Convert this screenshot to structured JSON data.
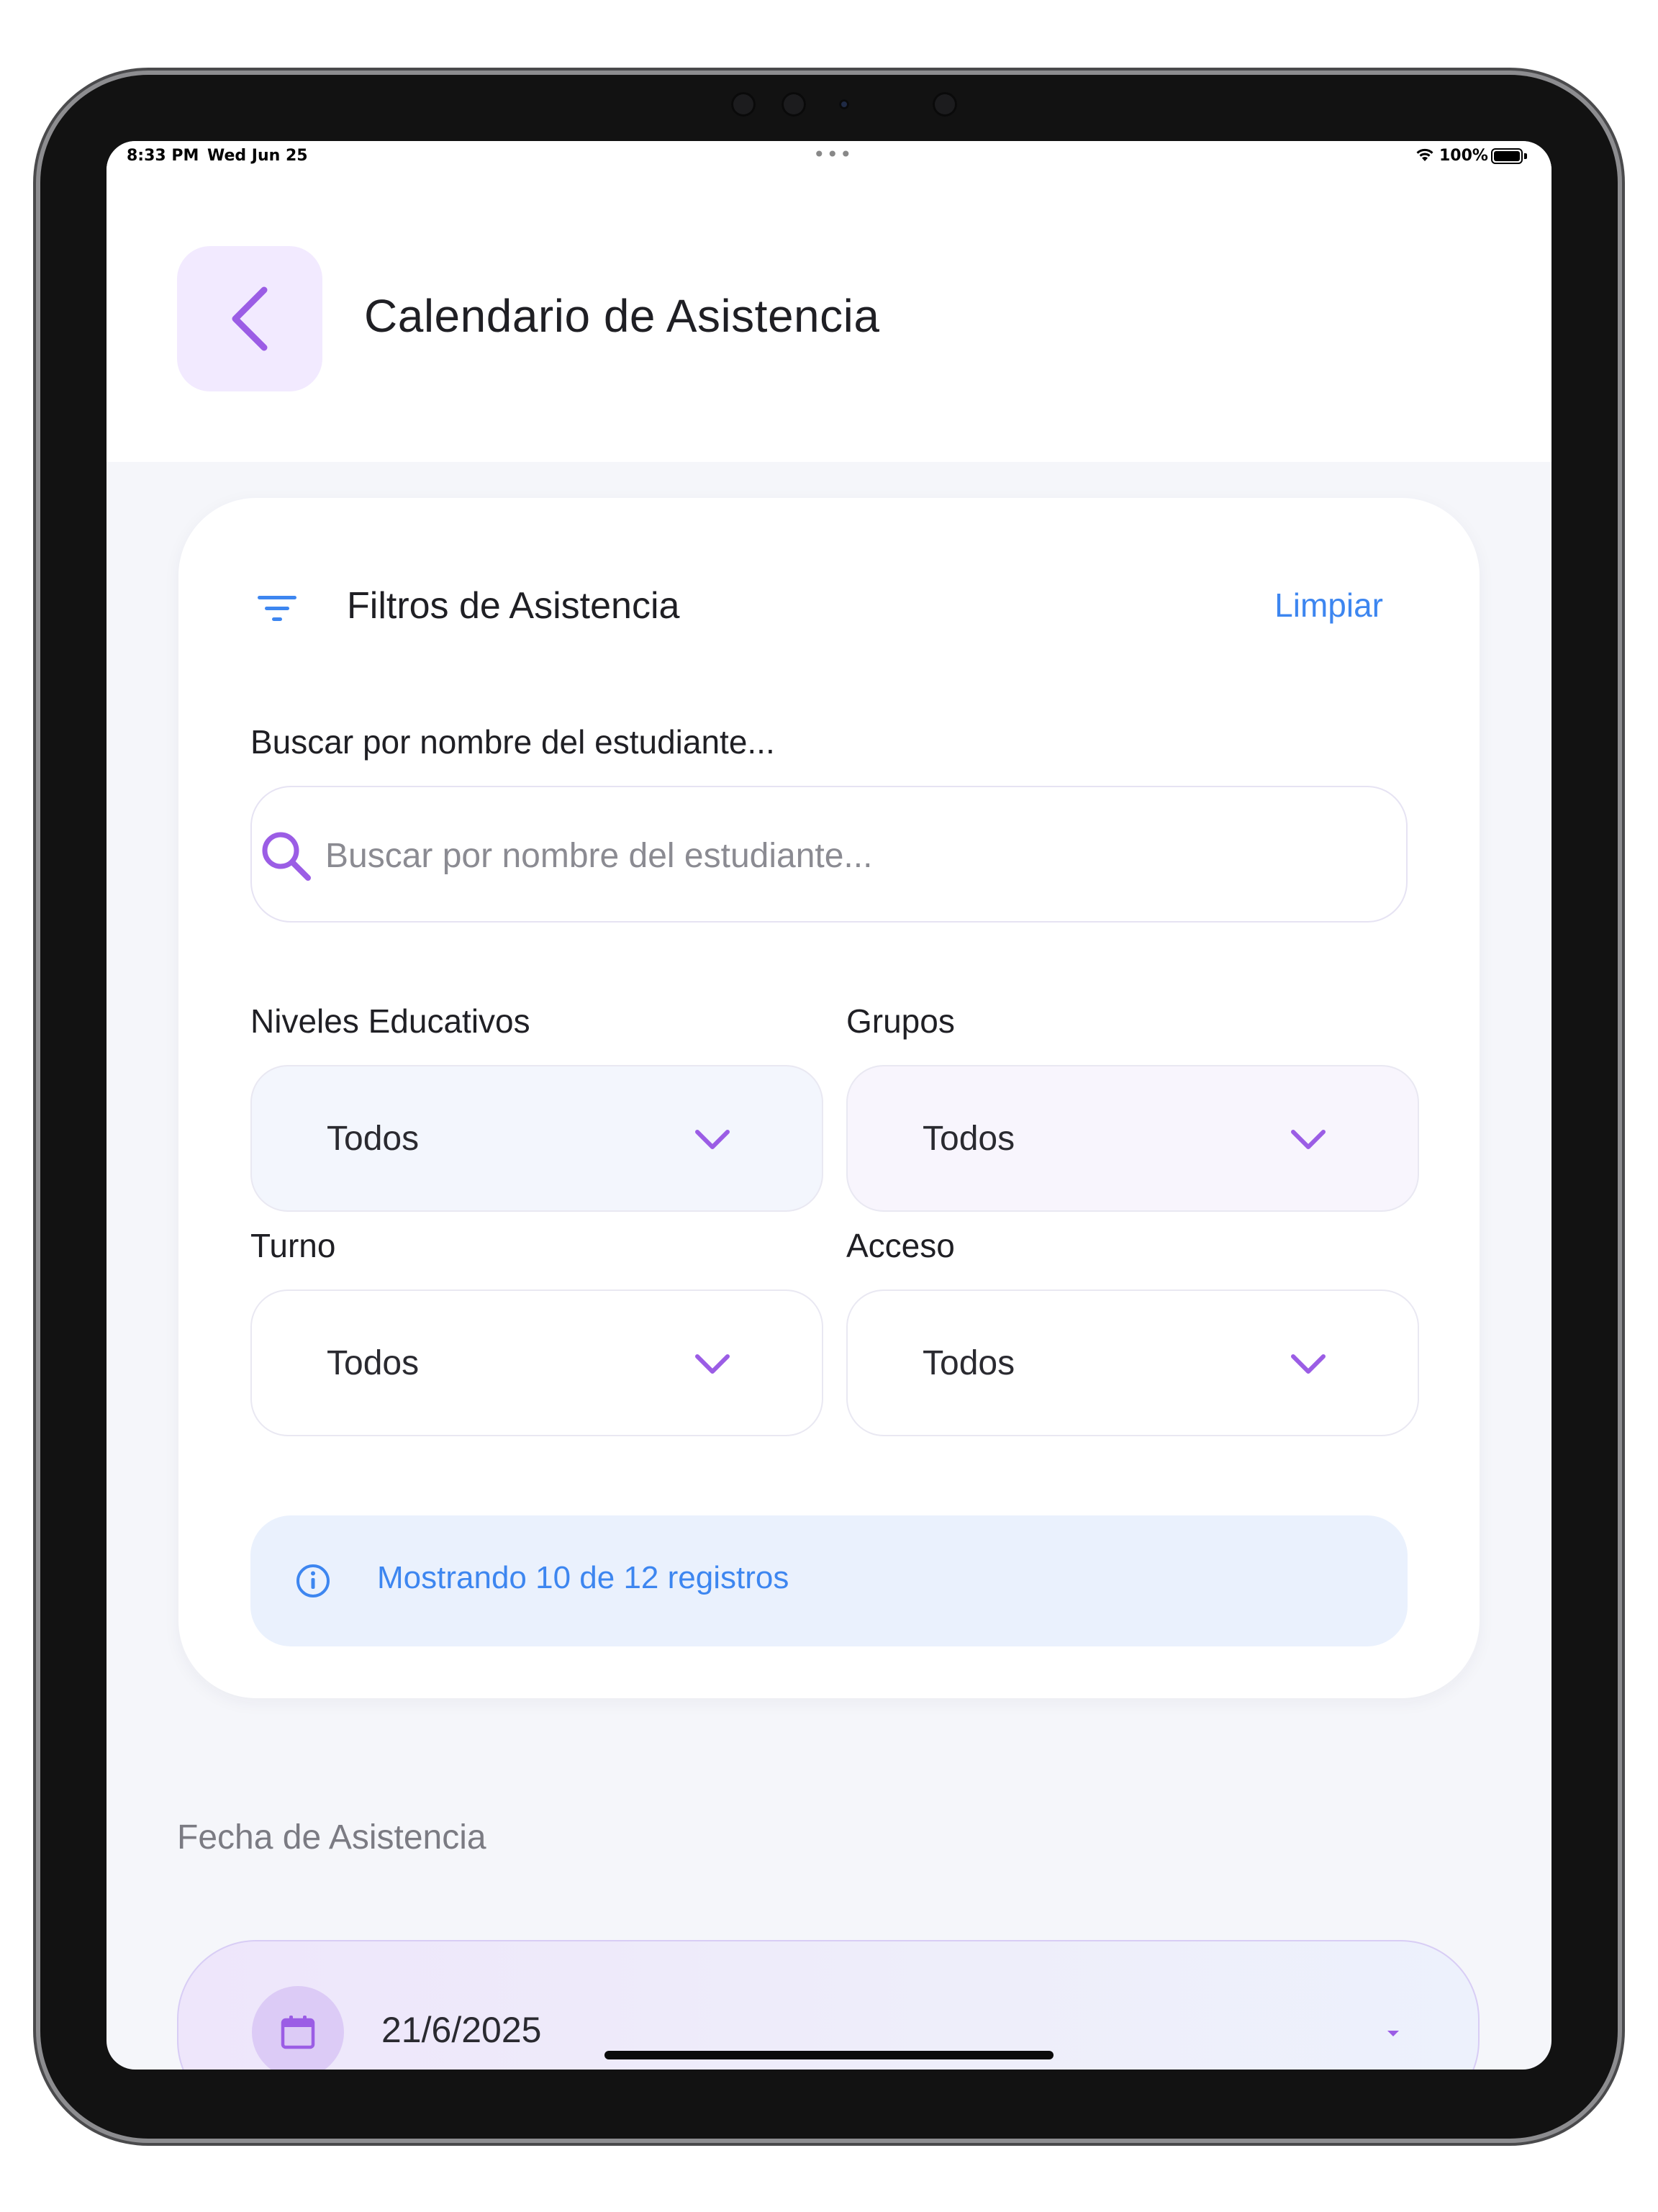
{
  "status_bar": {
    "time": "8:33 PM",
    "date": "Wed Jun 25",
    "battery": "100%"
  },
  "header": {
    "title": "Calendario de Asistencia",
    "back_icon": "chevron-left-icon"
  },
  "filters": {
    "title": "Filtros de Asistencia",
    "clear_label": "Limpiar",
    "search": {
      "label": "Buscar por nombre del estudiante...",
      "placeholder": "Buscar por nombre del estudiante...",
      "value": ""
    },
    "niveles": {
      "label": "Niveles Educativos",
      "value": "Todos"
    },
    "grupos": {
      "label": "Grupos",
      "value": "Todos"
    },
    "turno": {
      "label": "Turno",
      "value": "Todos"
    },
    "acceso": {
      "label": "Acceso",
      "value": "Todos"
    },
    "info_text": "Mostrando 10 de 12 registros"
  },
  "date_section": {
    "label": "Fecha de Asistencia",
    "value": "21/6/2025"
  },
  "colors": {
    "accent_purple": "#9b5de5",
    "link_blue": "#3d86f0",
    "back_button_bg": "#f2eaff"
  }
}
